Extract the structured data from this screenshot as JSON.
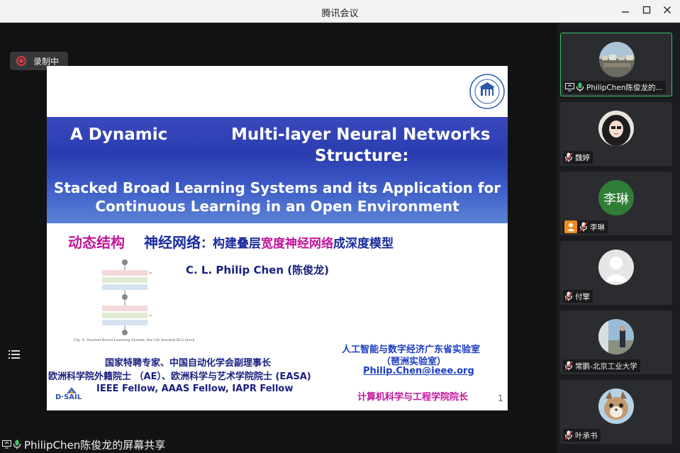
{
  "window": {
    "title": "腾讯会议"
  },
  "recording": {
    "label": "录制中"
  },
  "slide": {
    "title_line1_left": "A Dynamic",
    "title_line1_right": "Multi-layer Neural Networks",
    "title_line2": "Structure:",
    "subtitle_line1": "Stacked Broad Learning Systems and its Application for",
    "subtitle_line2": "Continuous Learning in an Open Environment",
    "zh_part1": "动态结构",
    "zh_part2": "神经网络",
    "zh_part3": "：构建叠层",
    "zh_part4": "宽度神经网络",
    "zh_part5": "成深度模型",
    "author": "C. L. Philip Chen (陈俊龙)",
    "figure_caption": "Fig. 4. Stacked Broad Learning System: the i-th Stacked BLS block",
    "roles_line1": "国家特聘专家、中国自动化学会副理事长",
    "roles_line2": "欧洲科学院外籍院士 （AE）、欧洲科学与艺术学院院士 (EASA)",
    "fellows": "IEEE Fellow, AAAS Fellow, IAPR Fellow",
    "lab_line1": "人工智能与数字经济广东省实验室",
    "lab_line2": "（琶洲实验室）",
    "email": "Philip.Chen@ieee.org",
    "dean": "计算机科学与工程学院院长",
    "page_number": "1",
    "dsail_logo_text": "D·SAIL"
  },
  "share": {
    "label": "PhilipChen陈俊龙的屏幕共享"
  },
  "participants": [
    {
      "name": "PhilipChen陈俊龙的...",
      "active": true,
      "avatar_initial": "",
      "avatar_icon": "landscape-photo-avatar",
      "muted": false,
      "sharing": true
    },
    {
      "name": "魏婷",
      "active": false,
      "avatar_initial": "",
      "avatar_icon": "cartoon-girl-avatar",
      "muted": true,
      "sharing": false
    },
    {
      "name": "李琳",
      "active": false,
      "avatar_initial": "李琳",
      "avatar_icon": "green-initial-avatar",
      "muted": true,
      "sharing": false
    },
    {
      "name": "付擎",
      "active": false,
      "avatar_initial": "",
      "avatar_icon": "default-person-avatar",
      "muted": true,
      "sharing": false
    },
    {
      "name": "常鹏-北京工业大学",
      "active": false,
      "avatar_initial": "",
      "avatar_icon": "outdoor-photo-avatar",
      "muted": true,
      "sharing": false
    },
    {
      "name": "叶承书",
      "active": false,
      "avatar_initial": "",
      "avatar_icon": "cat-photo-avatar",
      "muted": true,
      "sharing": false
    }
  ],
  "colors": {
    "accent_green": "#3ec06a",
    "record_red": "#e03a3a",
    "slide_pink": "#c0179a",
    "slide_blue": "#1a2c9c"
  }
}
